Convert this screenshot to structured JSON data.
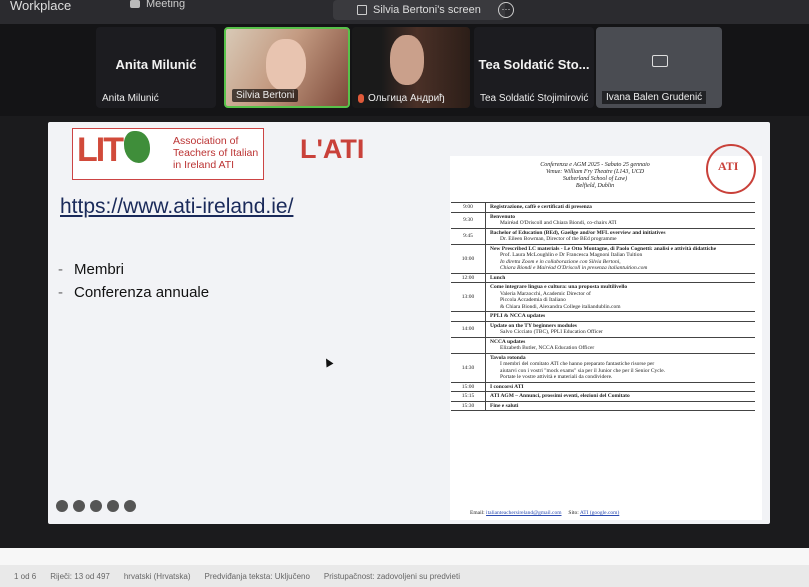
{
  "topbar": {
    "app_name": "Workplace",
    "meeting_label": "Meeting",
    "share_label": "Silvia Bertoni's screen",
    "more_icon": "more-icon"
  },
  "participants": [
    {
      "big": "Anita Milunić",
      "label": "Anita Milunić"
    },
    {
      "label": "Silvia Bertoni",
      "speaking_color": "#58c24a"
    },
    {
      "label": "Ольгица Андриђ"
    },
    {
      "big": "Tea Soldatić Sto...",
      "label": "Tea Soldatić Stojimirović"
    },
    {
      "label": "Ivana Balen Grudenić"
    }
  ],
  "slide": {
    "logo_letters": "LIT",
    "logo_lines": [
      "Association of",
      "Teachers of Italian",
      "in Ireland  ATI"
    ],
    "title": "L'ATI",
    "url": "https://www.ati-ireland.ie/",
    "bullets": [
      "Membri",
      "Conferenza annuale"
    ],
    "accent_color": "#c9413a"
  },
  "program": {
    "header": [
      "Conferenza e AGM 2025 - Sabato 25 gennaio",
      "Venue: William Fry Theatre (L143, UCD",
      "Sutherland School of Law)",
      "Belfield, Dublin"
    ],
    "seal_text": "ATI",
    "rows": [
      {
        "time": "9:00",
        "title": "Registrazione, caffè e certificati di presenza",
        "lines": []
      },
      {
        "time": "9:30",
        "title": "Benvenuto",
        "lines": [
          "Mairéad O'Driscoll and Chiara Biondi, co-chairs ATI"
        ]
      },
      {
        "time": "9:45",
        "title": "Bachelor of Education (BEd), Gaeilge and/or MFL overview and initiatives",
        "lines": [
          "Dr. Eileen Bowman, Director of the BEd programme"
        ]
      },
      {
        "time": "10:00",
        "title": "New Prescribed LC materials - Le Otto Montagne, di Paolo Cognetti: analisi e attività didattiche",
        "lines": [
          "Prof. Laura McLoughlin e Dr Francesca Magnoni   Italian Tuition",
          "In diretta Zoom e in collaborazione con Silvia Bertoni,",
          "Chiara Biondi e Mairéad O'Driscoll in presenza   italiantuition.com"
        ]
      },
      {
        "time": "12:00",
        "title": "Lunch",
        "lines": []
      },
      {
        "time": "13:00",
        "title": "Come integrare lingua e cultura: una proposta multilivello",
        "lines": [
          "Valeria Marzocchi, Academic Director of",
          "Piccola Accademia di Italiano",
          "& Chiara Biondi, Alexandra College   italiandublin.com"
        ]
      },
      {
        "time": "",
        "title": "PPLI & NCCA updates",
        "lines": []
      },
      {
        "time": "14:00",
        "title": "Update on the TY beginners modules",
        "lines": [
          "Salvo Cicciato (TBC), PPLI Education Officer"
        ]
      },
      {
        "time": "",
        "title": "NCCA updates",
        "lines": [
          "Elizabeth Butler, NCCA Education Officer"
        ]
      },
      {
        "time": "14:30",
        "title": "Tavola rotonda",
        "lines": [
          "I membri del comitato ATI che hanno preparato fantastiche risorse per",
          "aiutarvi con i vostri \"mock exams\" sia per il Junior che per il Senior Cycle.",
          "Portate le vostre attività e materiali da condividere."
        ]
      },
      {
        "time": "15:00",
        "title": "I concorsi ATI",
        "lines": []
      },
      {
        "time": "15:15",
        "title": "ATI AGM – Annunci, prossimi eventi, elezioni del Comitato",
        "lines": []
      },
      {
        "time": "15:30",
        "title": "Fine e saluti",
        "lines": []
      }
    ],
    "footer_email_label": "Email:",
    "footer_email": "italianteachersireland@gmail.com",
    "footer_site_label": "Sito:",
    "footer_site": "ATI (google.com)"
  },
  "statusbar": {
    "items": [
      "1 od 6",
      "Riječi: 13 od 497",
      "hrvatski (Hrvatska)",
      "Predviđanja teksta: Uključeno",
      "Pristupačnost: zadovoljeni su predvieti"
    ]
  }
}
